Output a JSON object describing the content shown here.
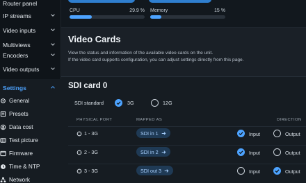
{
  "sidebar": {
    "router_panel": "Router panel",
    "items": [
      {
        "label": "IP streams"
      },
      {
        "label": "Video inputs"
      },
      {
        "label": "Multiviews"
      },
      {
        "label": "Encoders"
      },
      {
        "label": "Video outputs"
      }
    ],
    "settings_label": "Settings",
    "settings_items": [
      {
        "label": "General",
        "icon": "gear-icon"
      },
      {
        "label": "Presets",
        "icon": "presets-icon"
      },
      {
        "label": "Data cost",
        "icon": "data-cost-icon"
      },
      {
        "label": "Test picture",
        "icon": "test-picture-icon"
      },
      {
        "label": "Firmware",
        "icon": "firmware-icon"
      },
      {
        "label": "Time & NTP",
        "icon": "clock-icon"
      },
      {
        "label": "Network",
        "icon": "network-icon"
      }
    ]
  },
  "meters": {
    "cpu": {
      "label": "CPU",
      "value": "29.9 %",
      "fraction": 0.299
    },
    "memory": {
      "label": "Memory",
      "value": "15 %",
      "fraction": 0.15
    }
  },
  "page": {
    "title": "Video Cards",
    "desc1": "View the status and information of the available video cards on the unit.",
    "desc2": "If the video card supports configuration, you can adjust settings directly from this page."
  },
  "card": {
    "title": "SDI card 0",
    "standard_label": "SDI standard",
    "options": [
      {
        "label": "3G",
        "selected": true
      },
      {
        "label": "12G",
        "selected": false
      }
    ],
    "columns": {
      "port": "PHYSICAL PORT",
      "mapped": "MAPPED AS",
      "direction": "DIRECTION"
    },
    "rows": [
      {
        "port": "1 - 3G",
        "mapped": "SDI in 1",
        "input": "Input",
        "output": "Output",
        "direction": "input"
      },
      {
        "port": "2 - 3G",
        "mapped": "SDI in 2",
        "input": "Input",
        "output": "Output",
        "direction": "input"
      },
      {
        "port": "3 - 3G",
        "mapped": "SDI out 3",
        "input": "Input",
        "output": "Output",
        "direction": "output"
      }
    ]
  },
  "colors": {
    "accent": "#4da3ff",
    "background": "#0f1419",
    "panel": "#1a2027"
  }
}
